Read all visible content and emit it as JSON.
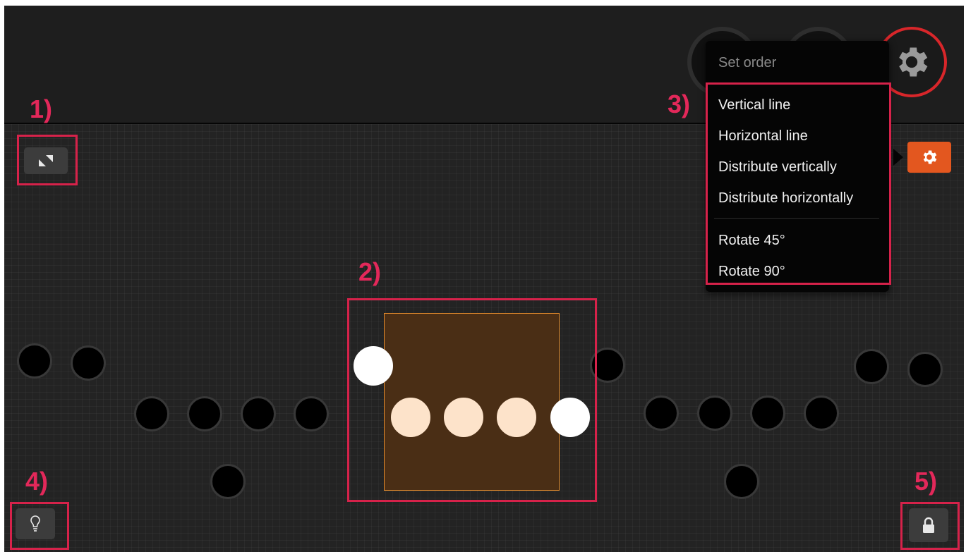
{
  "menu": {
    "title": "Set order",
    "items": [
      "Vertical line",
      "Horizontal line",
      "Distribute vertically",
      "Distribute horizontally",
      "Rotate 45°",
      "Rotate 90°"
    ]
  },
  "callouts": [
    "1)",
    "2)",
    "3)",
    "4)",
    "5)"
  ],
  "icons": {
    "resize": "resize-arrows-icon",
    "light": "lightbulb-icon",
    "lock": "lock-icon",
    "settings": "gear-icon"
  },
  "colors": {
    "callout": "#d6224a",
    "accent_orange": "#e3571f",
    "selection_fill": "#4a2e15",
    "selection_border": "#e38b2c",
    "pad_lit": "#fde3ca",
    "record_ring": "#d8262a"
  }
}
